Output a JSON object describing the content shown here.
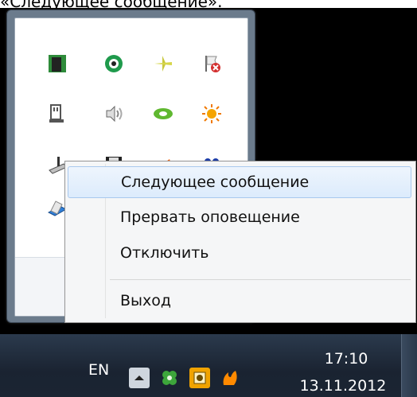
{
  "caption": "«Следующее сообщение».",
  "tray": {
    "icons": [
      "network-device-icon",
      "green-ring-icon",
      "airplane-icon",
      "flag-error-icon",
      "usb-device-icon",
      "speaker-icon",
      "nvidia-icon",
      "sun-icon",
      "scanner-icon",
      "floppy-icon",
      "flame-icon",
      "people-icon",
      "printer-icon"
    ]
  },
  "context_menu": {
    "items": [
      {
        "label": "Следующее сообщение",
        "selected": true
      },
      {
        "label": "Прервать оповещение",
        "selected": false
      },
      {
        "label": "Отключить",
        "selected": false
      },
      {
        "label": "Выход",
        "selected": false
      }
    ]
  },
  "taskbar": {
    "language": "EN",
    "time": "17:10",
    "date": "13.11.2012"
  }
}
